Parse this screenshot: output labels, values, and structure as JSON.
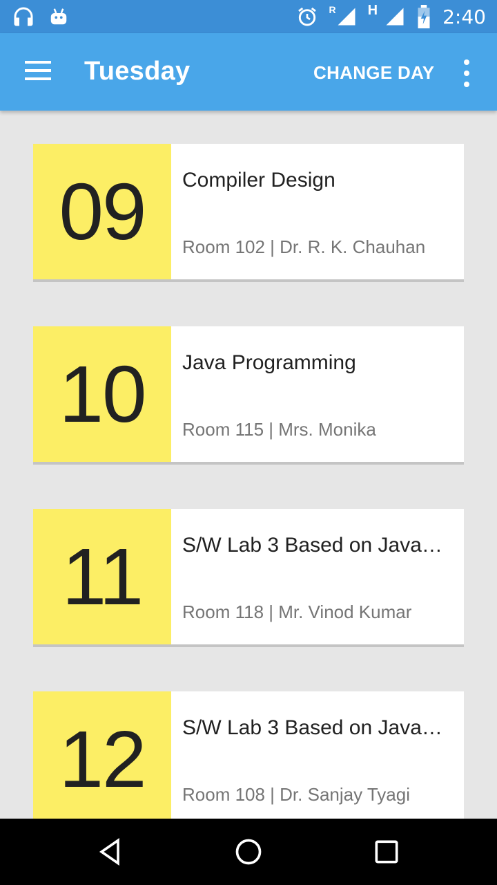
{
  "status_bar": {
    "time": "2:40",
    "network_r": "R",
    "network_h": "H",
    "icons": [
      "headphones-icon",
      "android-icon",
      "alarm-icon",
      "signal-icon",
      "battery-charging-icon"
    ]
  },
  "app_bar": {
    "title": "Tuesday",
    "action_label": "CHANGE DAY",
    "bg_color": "#49a6e9"
  },
  "schedule": [
    {
      "period": "09",
      "subject": "Compiler Design",
      "details": "Room 102 | Dr. R. K. Chauhan"
    },
    {
      "period": "10",
      "subject": "Java Programming",
      "details": "Room 115 | Mrs. Monika"
    },
    {
      "period": "11",
      "subject": "S/W Lab 3 Based on Java…",
      "details": "Room 118 | Mr. Vinod Kumar"
    },
    {
      "period": "12",
      "subject": "S/W Lab 3 Based on Java…",
      "details": "Room 108 | Dr. Sanjay Tyagi"
    }
  ],
  "colors": {
    "accent_period": "#fcee65",
    "status_bar": "#3c8ed6"
  },
  "nav_bar": {
    "icons": [
      "back-icon",
      "home-icon",
      "recents-icon"
    ]
  }
}
